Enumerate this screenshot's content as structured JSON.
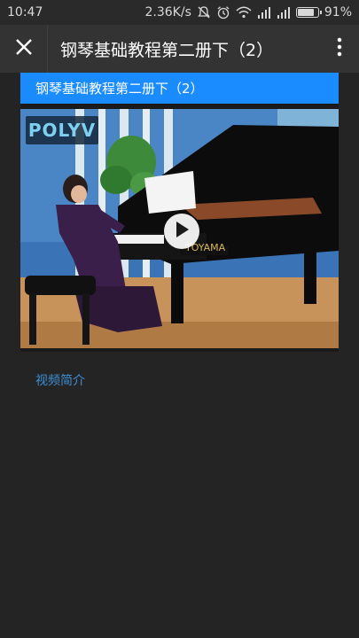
{
  "status_bar": {
    "time": "10:47",
    "network_speed": "2.36K/s",
    "battery_percent": "91%",
    "battery_level": 0.91,
    "icons": [
      "silent-bell-icon",
      "alarm-icon",
      "wifi-icon",
      "signal-icon",
      "signal-icon",
      "battery-icon"
    ]
  },
  "app_bar": {
    "title": "钢琴基础教程第二册下（2）",
    "close_icon": "close-icon",
    "more_icon": "more-vert-icon"
  },
  "video": {
    "header_title": "钢琴基础教程第二册下（2）",
    "watermark_text": "POLYV",
    "brand_on_piano": "TOYAMA",
    "play_icon": "play-icon"
  },
  "intro_link_label": "视频简介"
}
